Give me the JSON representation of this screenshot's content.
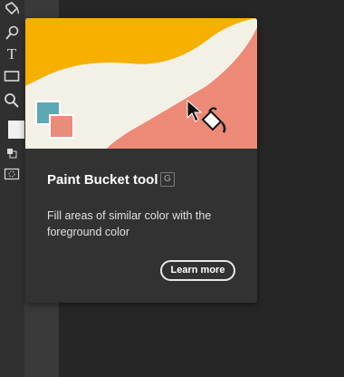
{
  "toolbar": {
    "tools": [
      {
        "icon": "paint-bucket-icon"
      },
      {
        "icon": "blur-drop-icon"
      },
      {
        "icon": "dodge-icon"
      },
      {
        "icon": "type-icon",
        "glyph": "T"
      },
      {
        "icon": "rectangle-icon"
      },
      {
        "icon": "zoom-icon"
      },
      {
        "icon": "color-swatches-icon"
      },
      {
        "icon": "quick-mask-icon"
      }
    ]
  },
  "tooltip": {
    "title": "Paint Bucket tool",
    "shortcut": "G",
    "description": "Fill areas of similar color with the foreground color",
    "learn_more_label": "Learn more"
  },
  "colors": {
    "illustration_yellow": "#f5b000",
    "illustration_cream": "#f3f1e6",
    "illustration_salmon": "#ec8a77",
    "swatch_teal": "#5aa9b4",
    "swatch_pink": "#e98d7b",
    "tooltip_bg": "#323232"
  }
}
